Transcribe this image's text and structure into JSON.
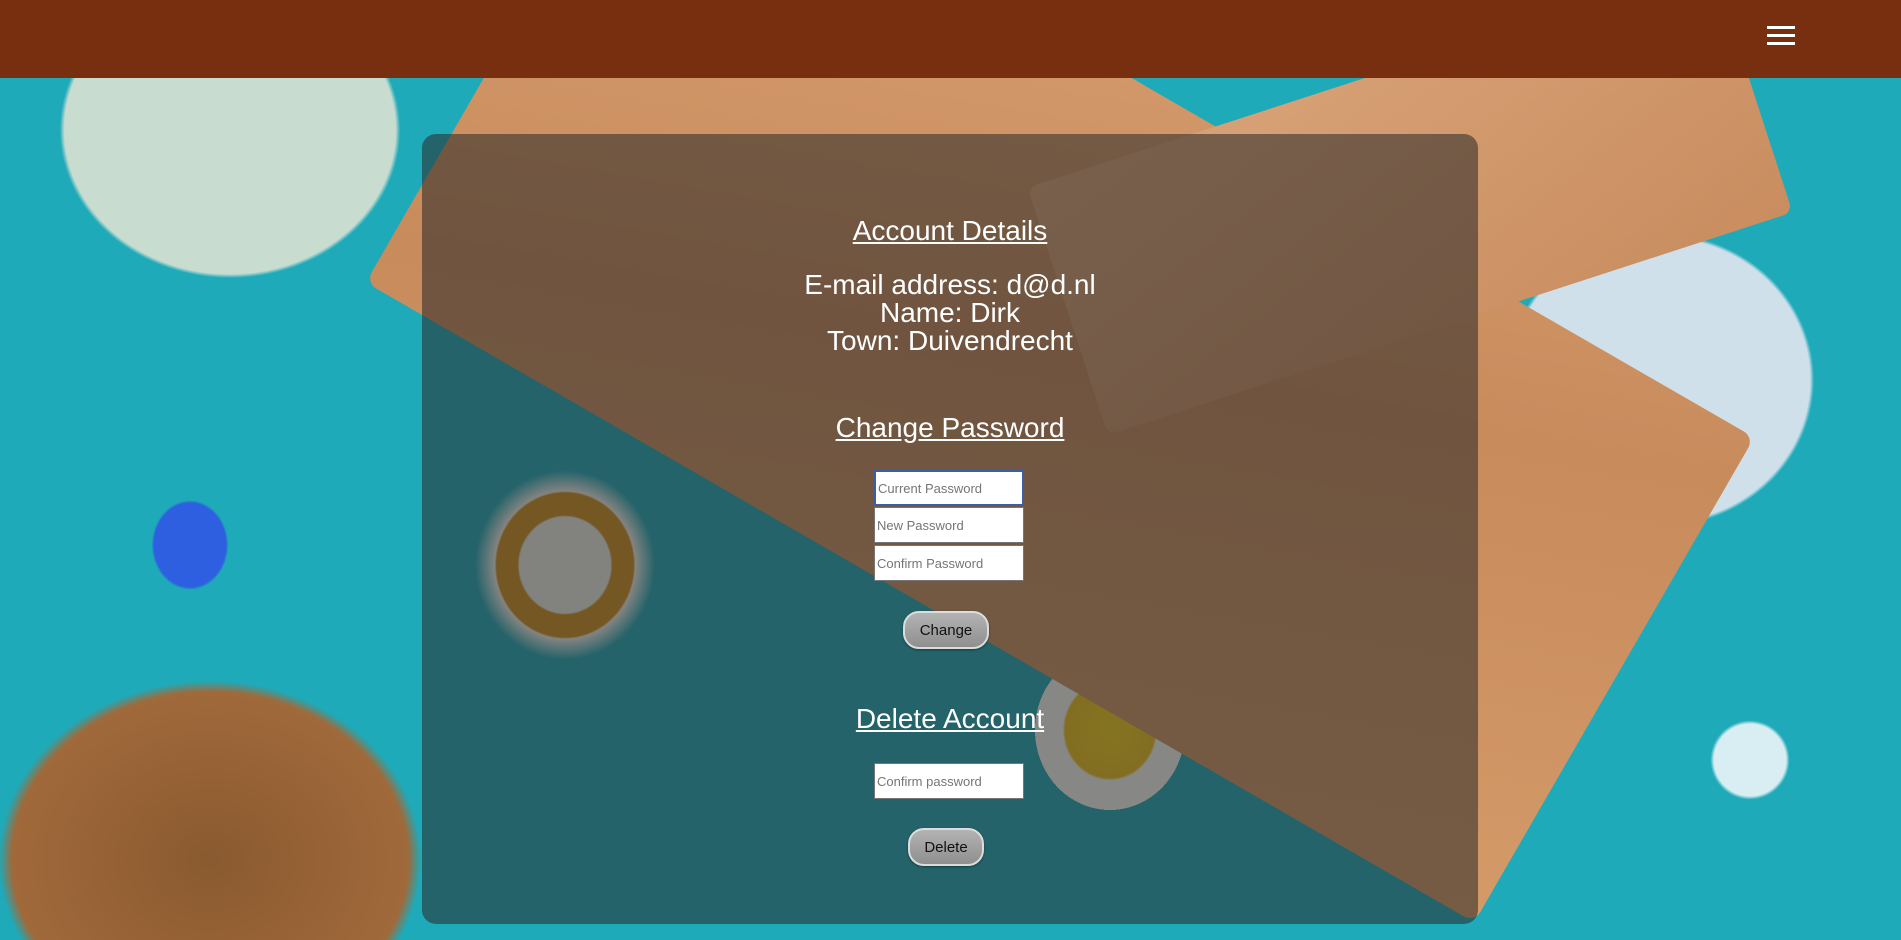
{
  "account_details": {
    "heading": "Account Details",
    "email_line": "E-mail address: d@d.nl",
    "name_line": "Name: Dirk",
    "town_line": "Town: Duivendrecht"
  },
  "change_password": {
    "heading": "Change Password",
    "current_placeholder": "Current Password",
    "new_placeholder": "New Password",
    "confirm_placeholder": "Confirm Password",
    "button_label": "Change"
  },
  "delete_account": {
    "heading": "Delete Account",
    "confirm_placeholder": "Confirm password",
    "button_label": "Delete"
  },
  "navbar": {
    "menu_icon": "hamburger-menu-icon",
    "color": "#772f10"
  }
}
